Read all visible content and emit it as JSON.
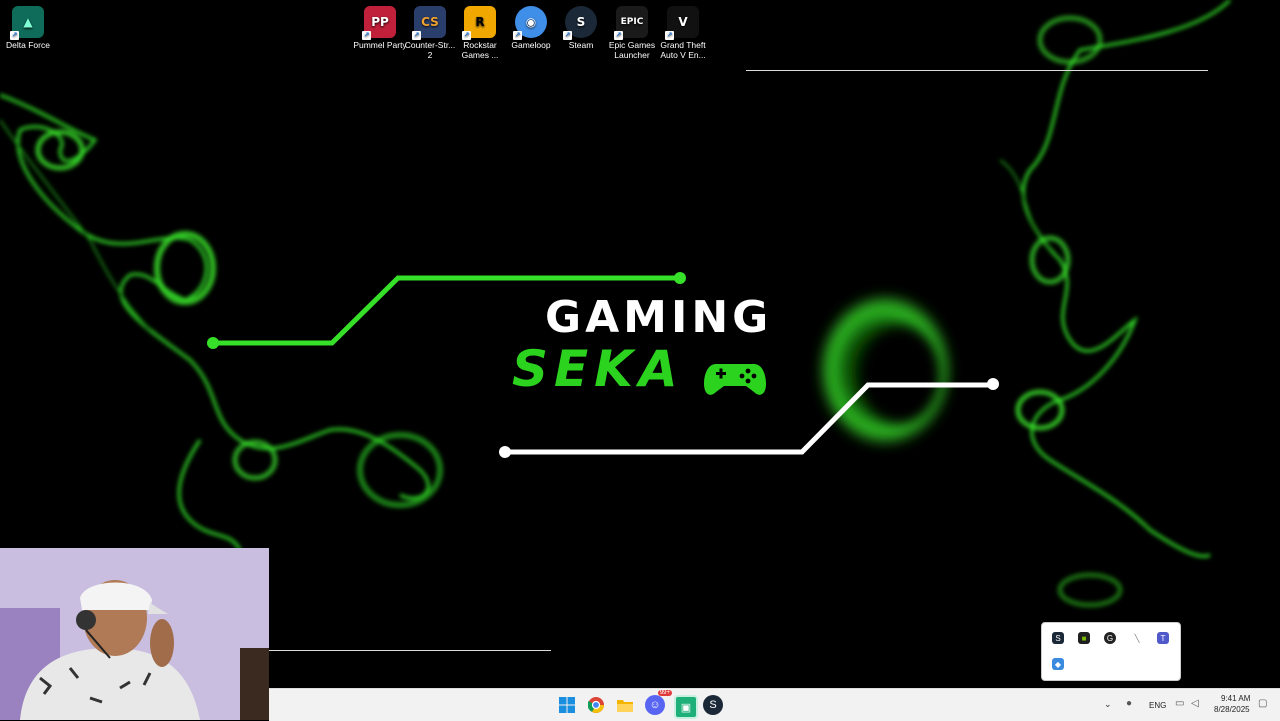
{
  "desktop_icons": [
    {
      "label": "Delta Force",
      "icon": "delta-force-icon",
      "color": "#0f6b5a",
      "glyph": "▲"
    },
    {
      "label": "Pummel Party",
      "icon": "pummel-party-icon",
      "color": "#c0203a",
      "glyph": "PP"
    },
    {
      "label": "Counter-Str... 2",
      "icon": "counter-strike-icon",
      "color": "#2a3e6b",
      "glyph": "CS"
    },
    {
      "label": "Rockstar Games ...",
      "icon": "rockstar-games-icon",
      "color": "#f0a800",
      "glyph": "R"
    },
    {
      "label": "Gameloop",
      "icon": "gameloop-icon",
      "color": "#3f8ee8",
      "glyph": "◉"
    },
    {
      "label": "Steam",
      "icon": "steam-icon",
      "color": "#1b2838",
      "glyph": "S"
    },
    {
      "label": "Epic Games Launcher",
      "icon": "epic-games-icon",
      "color": "#1a1a1a",
      "glyph": "EPIC"
    },
    {
      "label": "Grand Theft Auto V En...",
      "icon": "gta-v-icon",
      "color": "#111",
      "glyph": "V"
    }
  ],
  "wallpaper": {
    "title_top": "GAMING",
    "title_bottom": "SEKA",
    "accent_color": "#2bd31e"
  },
  "taskbar": {
    "apps": [
      "windows-start-icon",
      "chrome-icon",
      "file-explorer-icon",
      "discord-icon",
      "app-icon",
      "steam-icon"
    ],
    "discord_badge": "99+",
    "language": "ENG",
    "time": "9:41 AM",
    "date": "8/28/2025"
  },
  "tray_popup": {
    "icons": [
      "steam-tray-icon",
      "nvidia-tray-icon",
      "g-hub-tray-icon",
      "pen-tray-icon",
      "teams-tray-icon",
      "security-tray-icon"
    ]
  }
}
